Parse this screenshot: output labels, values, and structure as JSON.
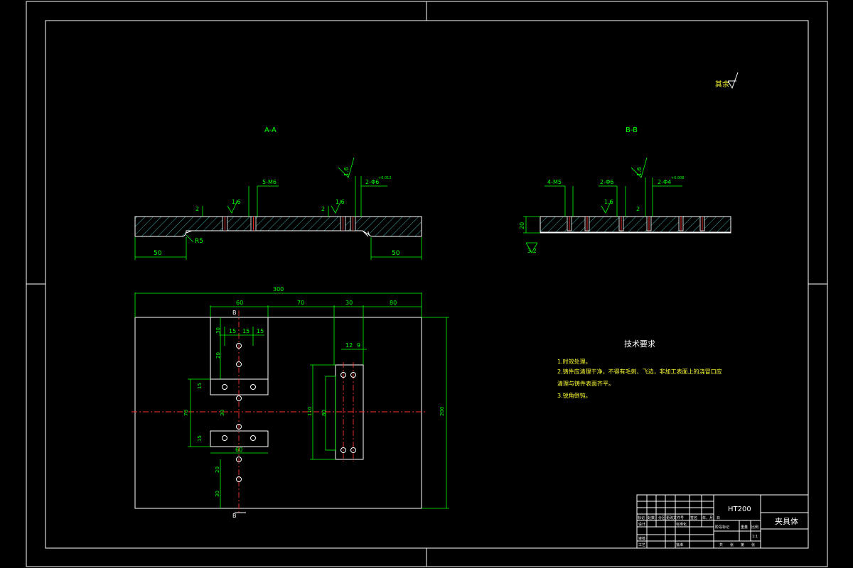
{
  "section_labels": {
    "a": "A-A",
    "b": "B-B"
  },
  "roughness_note": "其余",
  "section_a": {
    "callouts": {
      "m6": "5-M6",
      "hole_fit": "2-Φ6",
      "tol": "+0.012\n0",
      "r1": "1.6",
      "r2": "1.6",
      "r3": "1.6"
    },
    "dims": {
      "depth1": "2",
      "depth2": "2",
      "radius": "R5",
      "left": "50",
      "right": "50"
    }
  },
  "section_b": {
    "callouts": {
      "m5": "4-M5",
      "h6": "2-Φ6",
      "h4": "2-Φ4",
      "tol": "+0.008\n0",
      "r1": "1.6",
      "r2": "1.6"
    },
    "dims": {
      "thickness": "20",
      "depth": "2",
      "bottom_roughness": "3.2"
    }
  },
  "plan": {
    "dims": {
      "overall": "300",
      "d60": "60",
      "d70": "70",
      "d30": "30",
      "d80": "80",
      "d15a": "15",
      "d15b": "15",
      "d15c": "15",
      "v30a": "30",
      "v20": "20",
      "v15a": "15",
      "v70": "70",
      "v30b": "30",
      "v15b": "15",
      "d60b": "60",
      "v20b": "20",
      "v30c": "30",
      "d12": "12",
      "d9": "9",
      "v110": "110",
      "v80": "80",
      "v200": "200"
    },
    "section_mark_top": "B",
    "section_mark_bottom": "B"
  },
  "tech": {
    "title": "技术要求",
    "items": [
      "1.时效处理。",
      "2.铸件应清理干净，不得有毛刺、飞边，非加工表面上的浇冒口应",
      "清理与铸件表面齐平。",
      "3.锐角倒钝。"
    ]
  },
  "title_block": {
    "material": "HT200",
    "name": "夹具体",
    "row_labels": [
      "标记",
      "处数",
      "分区",
      "更改文件号",
      "签名",
      "年、月、日"
    ],
    "roles": [
      "设计",
      "标准化",
      "审核",
      "工艺",
      "批准"
    ],
    "stage_headers": [
      "阶段标记",
      "重量",
      "比例"
    ],
    "scale": "1:1",
    "sheet_row": [
      "共",
      "张",
      "第",
      "张"
    ]
  }
}
